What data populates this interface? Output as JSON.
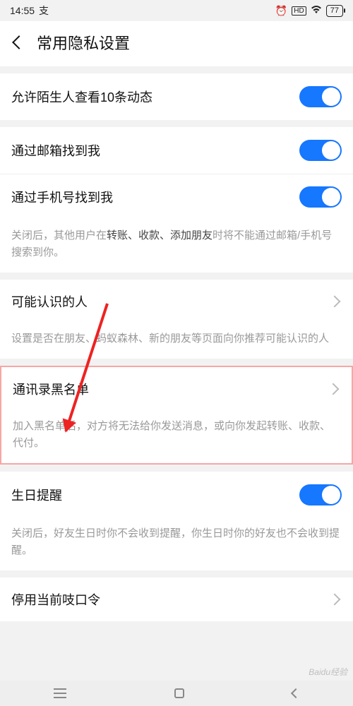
{
  "statusbar": {
    "time": "14:55",
    "alipay_glyph": "支",
    "hd": "HD",
    "battery": "77"
  },
  "header": {
    "title": "常用隐私设置"
  },
  "rows": {
    "stranger_feed": "允许陌生人查看10条动态",
    "find_by_email": "通过邮箱找到我",
    "find_by_phone": "通过手机号找到我",
    "possible_contacts": "可能认识的人",
    "blacklist": "通讯录黑名单",
    "birthday": "生日提醒",
    "disable_phrase": "停用当前吱口令"
  },
  "hints": {
    "find_prefix": "关闭后，其他用户在",
    "find_bold": "转账、收款、添加朋友",
    "find_suffix": "时将不能通过邮箱/手机号搜索到你。",
    "possible_contacts": "设置是否在朋友、蚂蚁森林、新的朋友等页面向你推荐可能认识的人",
    "blacklist": "加入黑名单后，对方将无法给你发送消息，或向你发起转账、收款、代付。",
    "birthday": "关闭后，好友生日时你不会收到提醒，你生日时你的好友也不会收到提醒。"
  },
  "watermark": "Baidu经验"
}
